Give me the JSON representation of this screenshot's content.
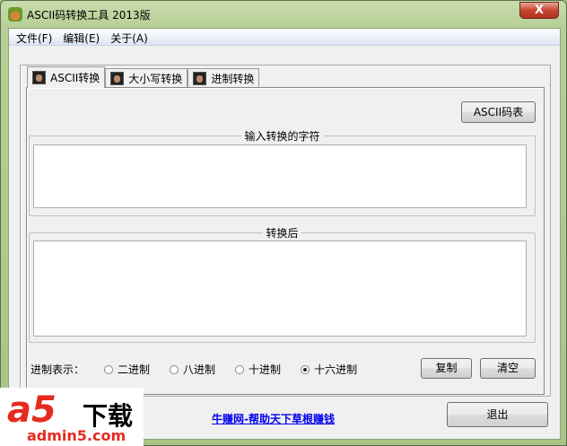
{
  "window": {
    "title": "ASCII码转换工具 2013版",
    "close_label": "X"
  },
  "menu": [
    "文件(F)",
    "编辑(E)",
    "关于(A)"
  ],
  "tabs": [
    "ASCII转换",
    "大小写转换",
    "进制转换"
  ],
  "ascii_table_button": "ASCII码表",
  "input_group": {
    "label": "输入转换的字符",
    "value": ""
  },
  "output_group": {
    "label": "转换后",
    "value": ""
  },
  "radix": {
    "label": "进制表示：",
    "options": [
      "二进制",
      "八进制",
      "十进制",
      "十六进制"
    ],
    "selected": "十六进制"
  },
  "copy_button": "复制",
  "clear_button": "清空",
  "exit_button": "退出",
  "link": "牛赚网-帮助天下草根赚钱",
  "watermark": {
    "text": "a5下载",
    "domain": "admin5.com"
  }
}
